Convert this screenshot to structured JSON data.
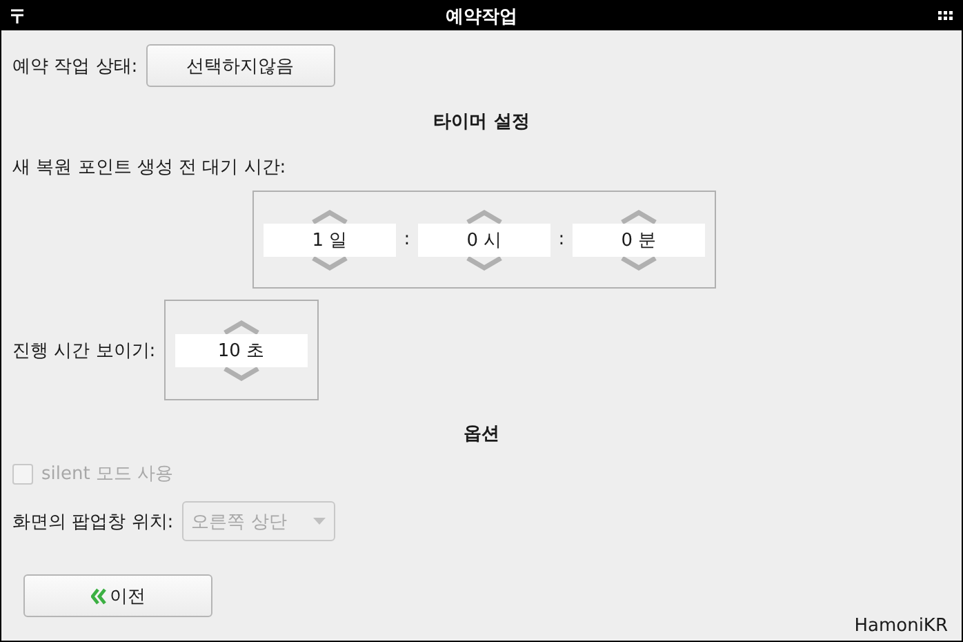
{
  "window": {
    "title": "예약작업"
  },
  "status": {
    "label": "예약 작업 상태:",
    "button": "선택하지않음"
  },
  "timer_section": {
    "heading": "타이머 설정",
    "wait_label": "새 복원 포인트 생성 전 대기 시간:",
    "spinners": [
      {
        "value": "1 일"
      },
      {
        "value": "0 시"
      },
      {
        "value": "0 분"
      }
    ],
    "separators": [
      ":",
      ":"
    ]
  },
  "progress": {
    "label": "진행 시간 보이기:",
    "value": "10 초"
  },
  "options": {
    "heading": "옵션",
    "silent": {
      "label": "silent 모드 사용",
      "checked": false,
      "disabled": true
    },
    "popup_position": {
      "label": "화면의 팝업창 위치:",
      "value": "오른쪽 상단",
      "disabled": true
    }
  },
  "buttons": [
    {
      "label": "이전"
    }
  ],
  "brand": "HamoniKR"
}
